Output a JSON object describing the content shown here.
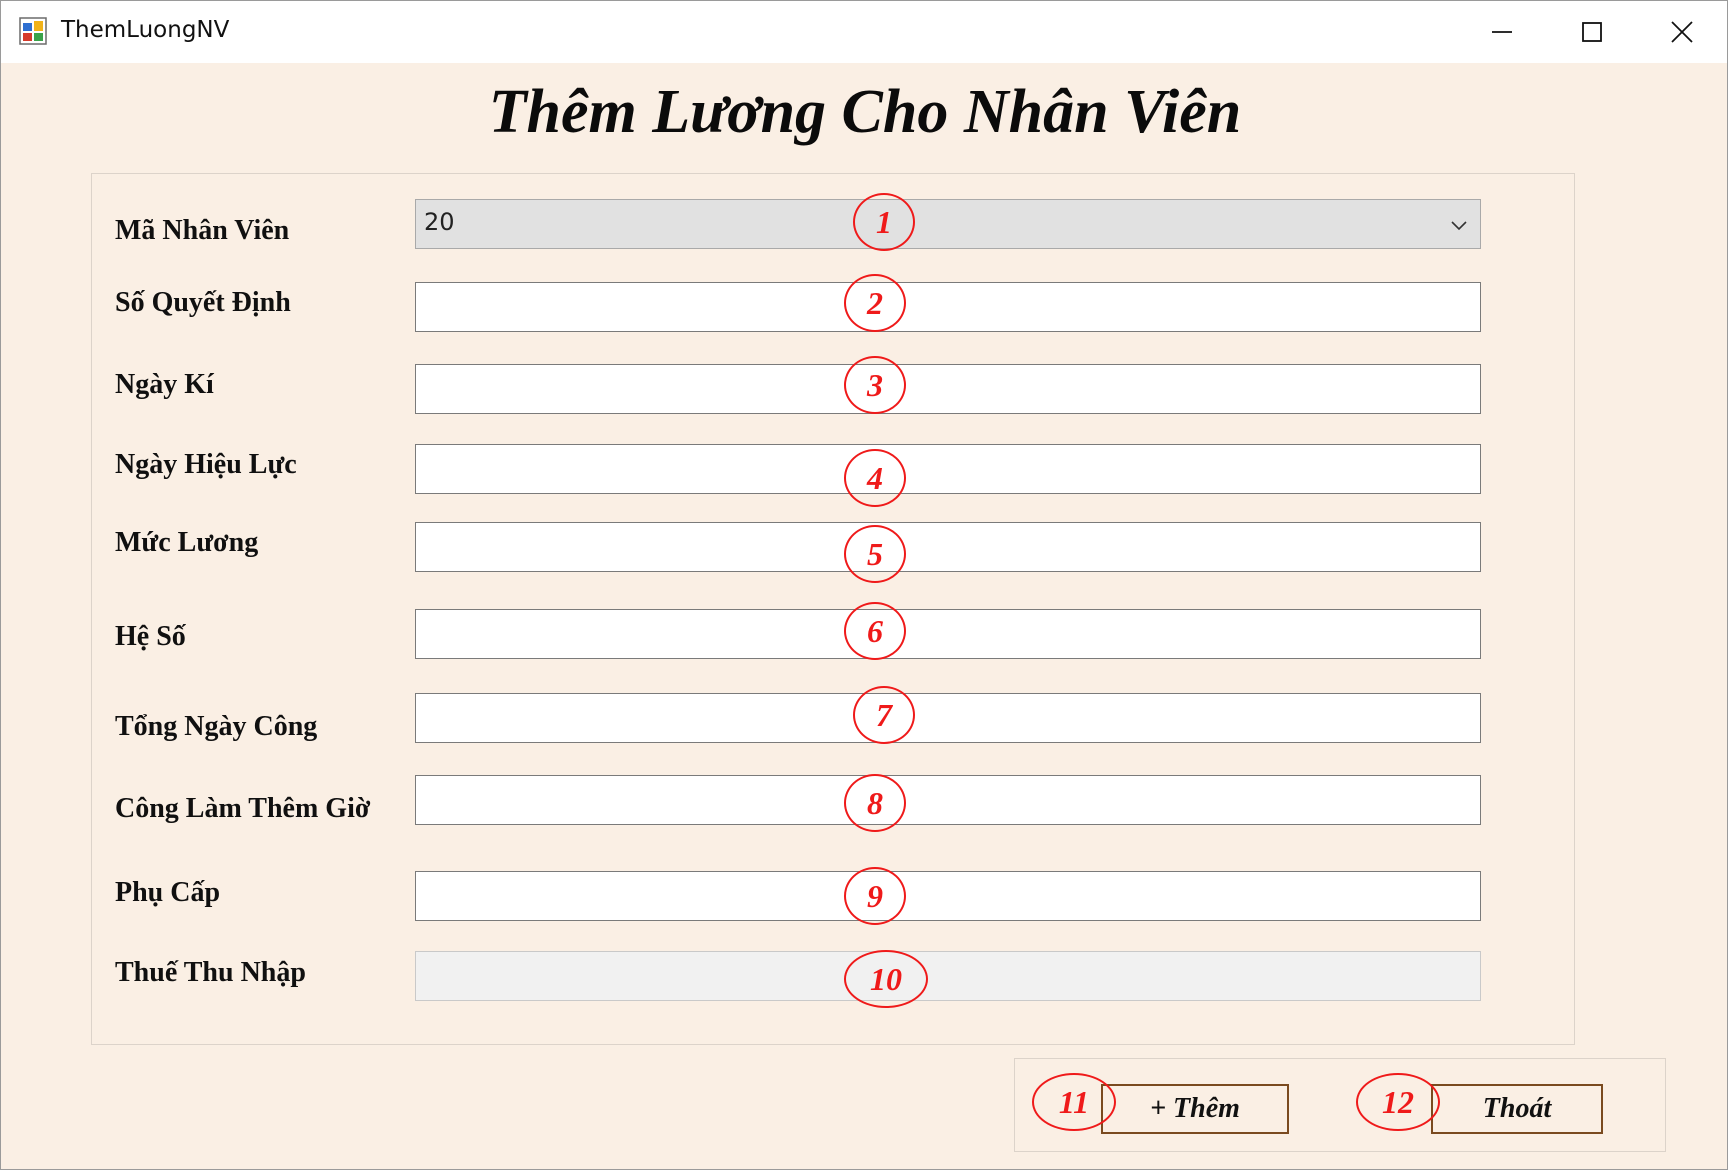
{
  "window": {
    "title": "ThemLuongNV",
    "controls": [
      "minimize-icon",
      "maximize-icon",
      "close-icon"
    ]
  },
  "heading": "Thêm Lương Cho Nhân Viên",
  "form": {
    "fields": [
      {
        "label": "Mã Nhân Viên",
        "value": "20",
        "type": "select",
        "marker": "1"
      },
      {
        "label": "Số Quyết Định",
        "value": "",
        "type": "text",
        "marker": "2"
      },
      {
        "label": "Ngày Kí",
        "value": "",
        "type": "text",
        "marker": "3"
      },
      {
        "label": "Ngày Hiệu Lực",
        "value": "",
        "type": "text",
        "marker": "4"
      },
      {
        "label": "Mức Lương",
        "value": "",
        "type": "text",
        "marker": "5"
      },
      {
        "label": "Hệ Số",
        "value": "",
        "type": "text",
        "marker": "6"
      },
      {
        "label": "Tổng Ngày Công",
        "value": "",
        "type": "text",
        "marker": "7"
      },
      {
        "label": "Công Làm Thêm Giờ",
        "value": "",
        "type": "text",
        "marker": "8"
      },
      {
        "label": "Phụ Cấp",
        "value": "",
        "type": "text",
        "marker": "9"
      },
      {
        "label": "Thuế Thu Nhập",
        "value": "",
        "type": "readonly",
        "marker": "10"
      }
    ]
  },
  "buttons": {
    "add": {
      "label": "+ Thêm",
      "marker": "11"
    },
    "exit": {
      "label": "Thoát",
      "marker": "12"
    }
  },
  "colors": {
    "background": "#faefe4",
    "marker": "#ef1a1a",
    "button_border": "#7a4a1f"
  }
}
